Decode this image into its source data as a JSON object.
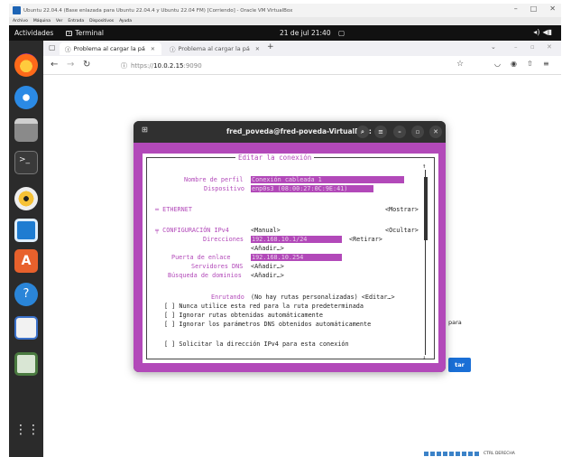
{
  "host": {
    "title": "Ubuntu 22.04.4 (Base enlazada para Ubuntu 22.04.4 y Ubuntu 22.04 FM) [Corriendo] - Oracle VM VirtualBox",
    "menu": [
      "Archivo",
      "Máquina",
      "Ver",
      "Entrada",
      "Dispositivos",
      "Ayuda"
    ],
    "controls": [
      "–",
      "□",
      "✕"
    ],
    "tray_text": "CTRL DERECHA"
  },
  "gnome": {
    "activities": "Actividades",
    "app": "Terminal",
    "clock": "21 de jul  21:40",
    "tray": [
      "◂)",
      "◀▮"
    ]
  },
  "browser": {
    "tabs": [
      {
        "label": "Problema al cargar la pá",
        "active": true
      },
      {
        "label": "Problema al cargar la pá",
        "active": false
      }
    ],
    "new_tab": "+",
    "url_prefix": "https://",
    "url_host": "10.0.2.15",
    "url_port": ":9090",
    "page_text_fragment": "para",
    "page_button_fragment": "tar"
  },
  "terminal": {
    "title": "fred_poveda@fred-poveda-VirtualBox: ~",
    "dialog": {
      "title": "Editar la conexión",
      "profile_label": "Nombre de perfil",
      "profile_value": "Conexión cableada 1",
      "device_label": "Dispositivo",
      "device_value": "enp0s3 (08:00:27:0C:9E:41)",
      "ethernet_section": "═ ETHERNET",
      "ethernet_action": "<Mostrar>",
      "ipv4_section": "╤ CONFIGURACIÓN IPv4",
      "ipv4_mode": "<Manual>",
      "ipv4_action": "<Ocultar>",
      "addresses_label": "Direcciones",
      "address_value": "192.168.10.1/24",
      "remove_button": "<Retirar>",
      "add_address": "<Añadir…>",
      "gateway_label": "Puerta de enlace",
      "gateway_value": "192.168.10.254",
      "dns_label": "Servidores DNS",
      "dns_add": "<Añadir…>",
      "search_label": "Búsqueda de dominios",
      "search_add": "<Añadir…>",
      "routing_label": "Enrutando",
      "routing_value": "(No hay rutas personalizadas) <Editar…>",
      "check1": "[ ] Nunca utilice esta red para la ruta predeterminada",
      "check2": "[ ] Ignorar rutas obtenidas automáticamente",
      "check3": "[ ] Ignorar los parámetros DNS obtenidos automáticamente",
      "check4": "[ ] Solicitar la dirección IPv4 para esta conexión"
    }
  }
}
